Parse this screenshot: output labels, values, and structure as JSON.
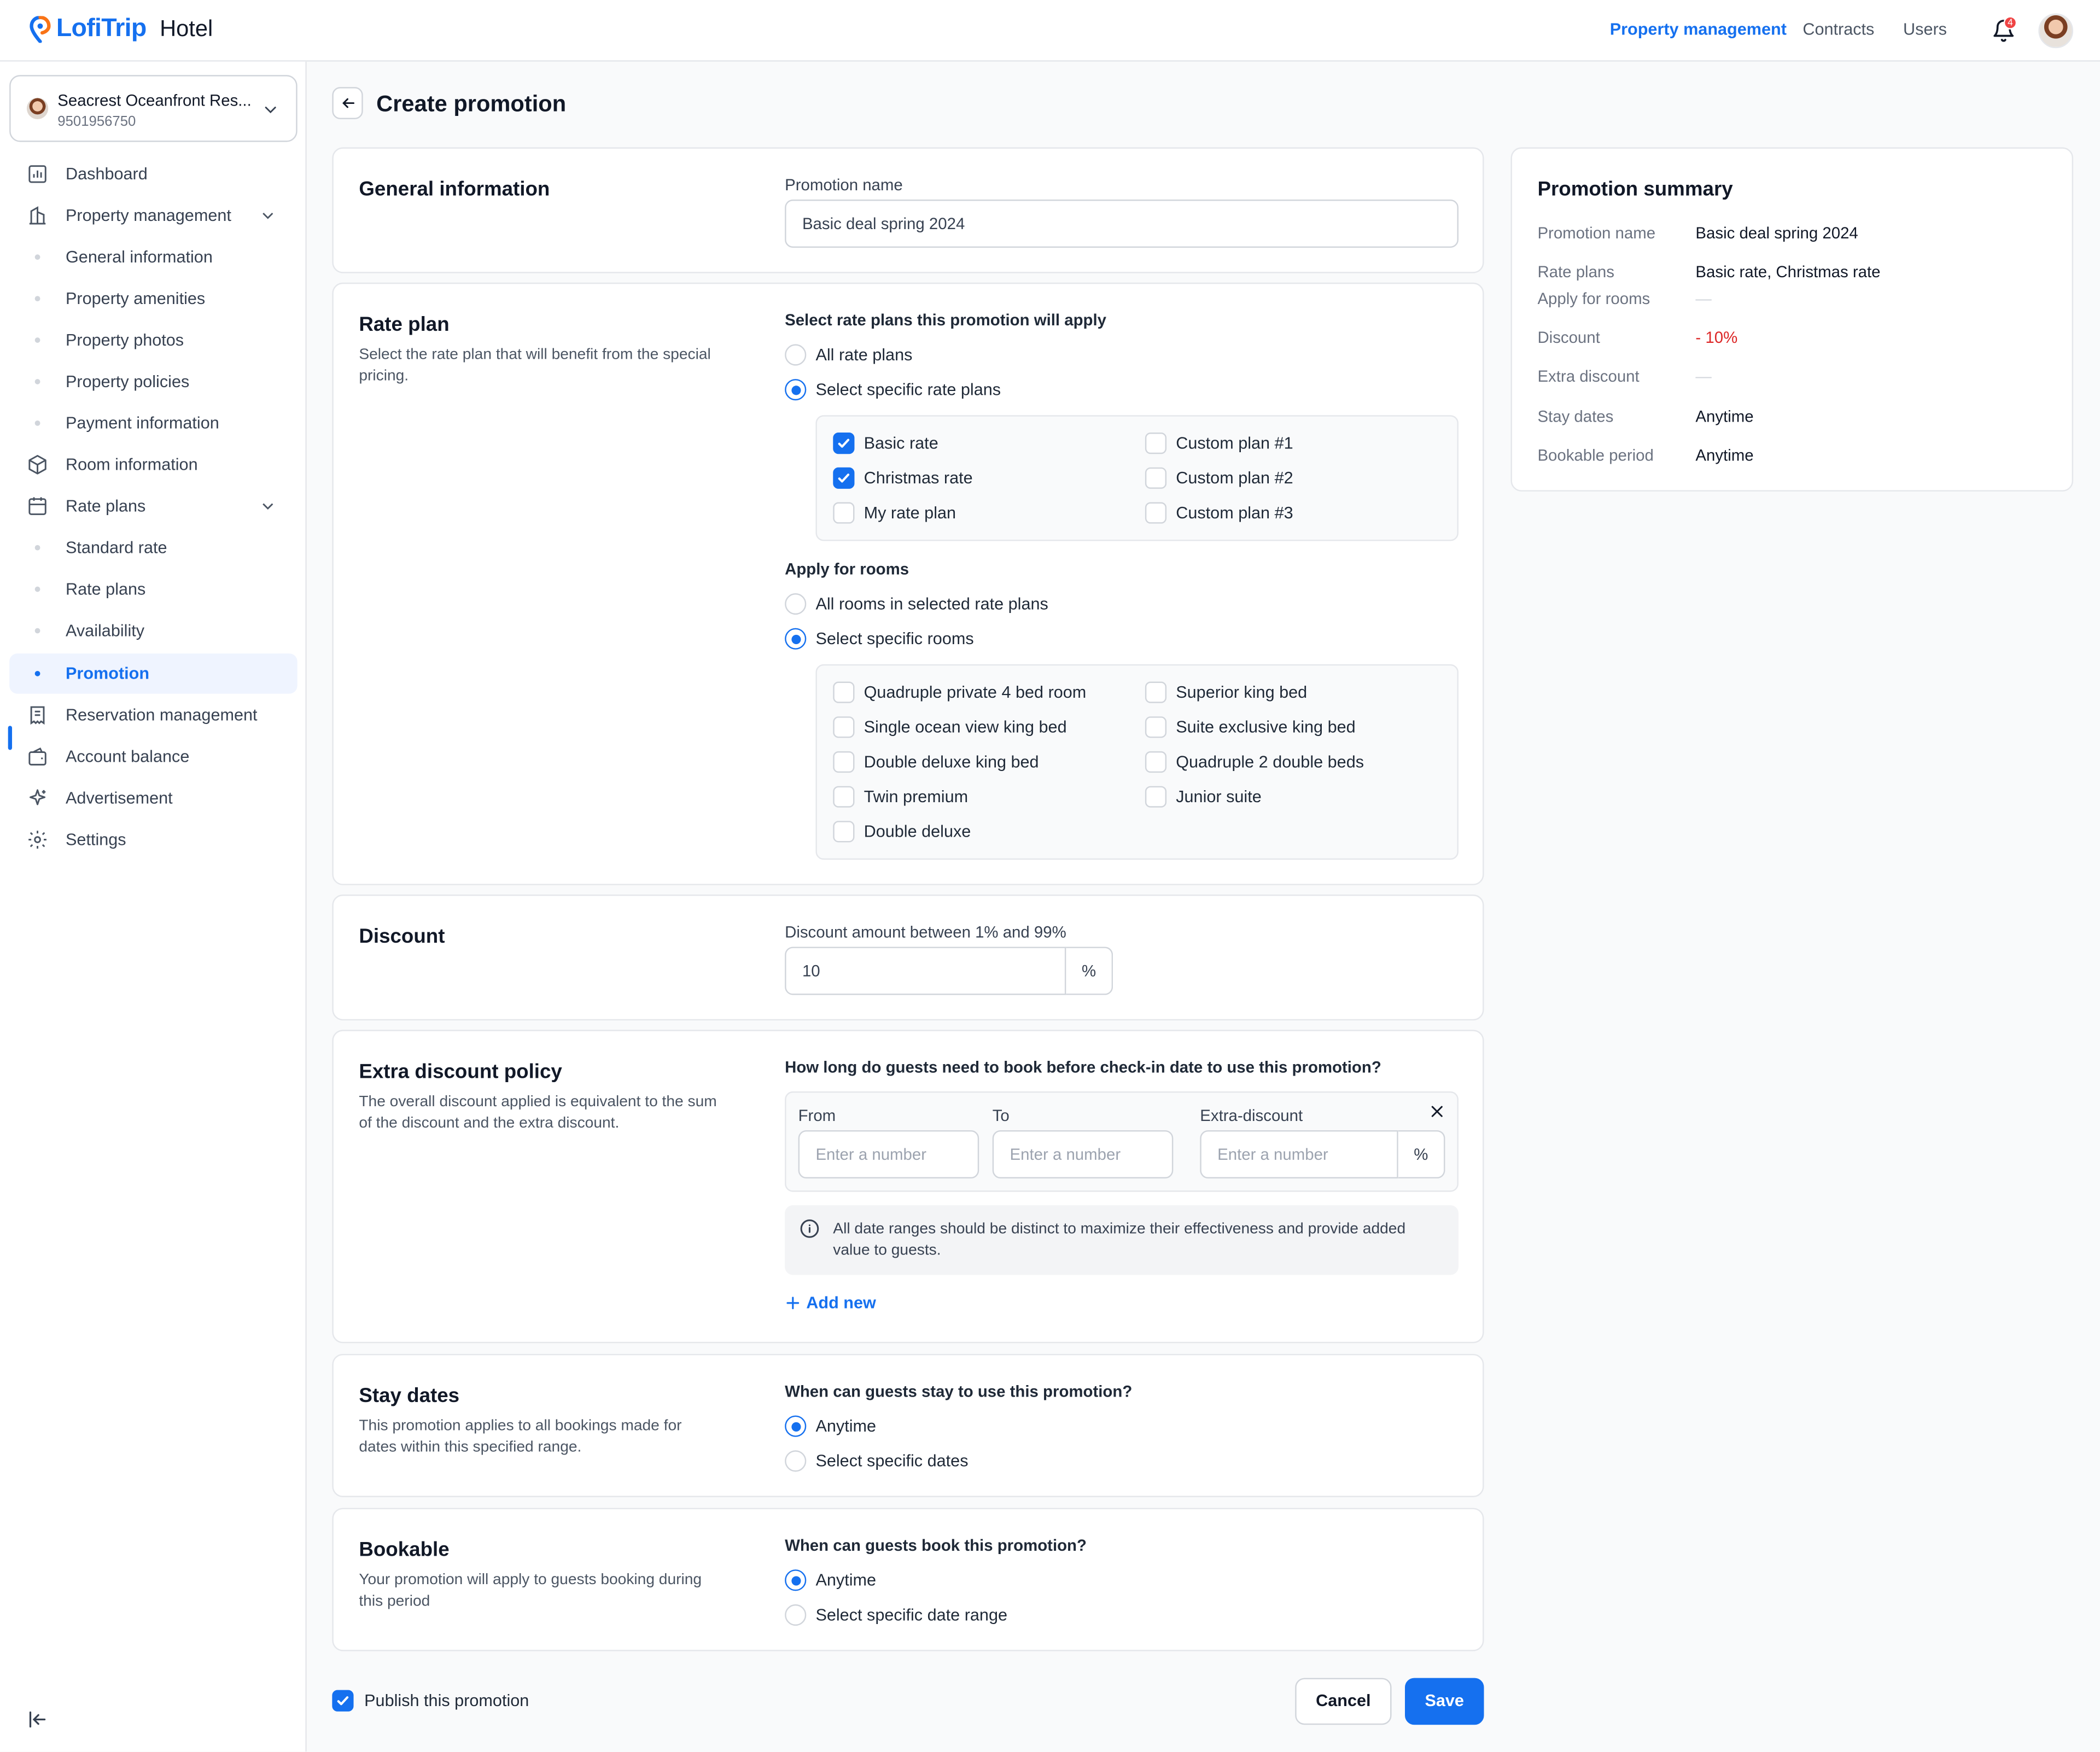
{
  "header": {
    "brand": "LofiTrip",
    "product": "Hotel",
    "nav": [
      {
        "label": "Property management",
        "active": true
      },
      {
        "label": "Contracts",
        "active": false
      },
      {
        "label": "Users",
        "active": false
      }
    ],
    "notification_count": "4",
    "accent_color": "#1570ef"
  },
  "sidebar": {
    "property": {
      "name": "Seacrest Oceanfront Res...",
      "id": "9501956750"
    },
    "items": [
      {
        "label": "Dashboard",
        "icon": "chart-bar-icon"
      },
      {
        "label": "Property management",
        "icon": "building-icon"
      },
      {
        "label": "General information"
      },
      {
        "label": "Property amenities"
      },
      {
        "label": "Property photos"
      },
      {
        "label": "Property policies"
      },
      {
        "label": "Payment information"
      },
      {
        "label": "Room information",
        "icon": "cube-icon"
      },
      {
        "label": "Rate plans",
        "icon": "calendar-icon"
      },
      {
        "label": "Standard rate"
      },
      {
        "label": "Rate plans"
      },
      {
        "label": "Availability"
      },
      {
        "label": "Promotion",
        "active": true
      },
      {
        "label": "Reservation management",
        "icon": "receipt-icon"
      },
      {
        "label": "Account balance",
        "icon": "wallet-icon"
      },
      {
        "label": "Advertisement",
        "icon": "sparkle-icon"
      },
      {
        "label": "Settings",
        "icon": "gear-icon"
      }
    ]
  },
  "page": {
    "title": "Create promotion"
  },
  "general": {
    "title": "General information",
    "name_label": "Promotion name",
    "name_value": "Basic deal spring 2024"
  },
  "rate_plan": {
    "title": "Rate plan",
    "desc": "Select the rate plan that will benefit from the special pricing.",
    "question": "Select rate plans this promotion will apply",
    "options": [
      "All rate plans",
      "Select specific rate plans"
    ],
    "plans": [
      {
        "label": "Basic rate",
        "checked": true
      },
      {
        "label": "Christmas rate",
        "checked": true
      },
      {
        "label": "My rate plan",
        "checked": false
      },
      {
        "label": "Custom plan #1",
        "checked": false
      },
      {
        "label": "Custom plan #2",
        "checked": false
      },
      {
        "label": "Custom plan #3",
        "checked": false
      }
    ],
    "rooms_question": "Apply for rooms",
    "rooms_options": [
      "All rooms in selected rate plans",
      "Select specific rooms"
    ],
    "rooms": [
      "Quadruple private 4 bed room",
      "Single ocean view king bed",
      "Double deluxe king bed",
      "Twin premium",
      "Double deluxe",
      "Superior king bed",
      "Suite exclusive king bed",
      "Quadruple 2 double beds",
      "Junior suite"
    ]
  },
  "discount": {
    "title": "Discount",
    "label": "Discount amount between 1% and 99%",
    "value": "10",
    "suffix": "%"
  },
  "extra": {
    "title": "Extra discount policy",
    "desc": "The overall discount applied is equivalent to the sum of the discount and the extra discount.",
    "question": "How long do guests need to book before check-in date to use this promotion?",
    "from_label": "From",
    "to_label": "To",
    "extra_label": "Extra-discount",
    "placeholder": "Enter a number",
    "suffix": "%",
    "info": "All date ranges should be distinct to maximize their effectiveness and provide added value to guests.",
    "add_new": "Add new"
  },
  "stay": {
    "title": "Stay dates",
    "desc": "This promotion applies to all bookings made for dates within this specified range.",
    "question": "When can guests stay to use this promotion?",
    "options": [
      "Anytime",
      "Select specific dates"
    ]
  },
  "bookable": {
    "title": "Bookable",
    "desc": "Your promotion will apply to guests booking during this period",
    "question": "When can guests book this promotion?",
    "options": [
      "Anytime",
      "Select specific date range"
    ]
  },
  "summary": {
    "title": "Promotion summary",
    "rows": [
      {
        "label": "Promotion name",
        "value": "Basic deal spring 2024"
      },
      {
        "label": "Rate plans",
        "value": "Basic rate, Christmas rate"
      },
      {
        "label": "Apply for rooms",
        "value": "—"
      },
      {
        "label": "Discount",
        "value": "- 10%"
      },
      {
        "label": "Extra discount",
        "value": "—"
      },
      {
        "label": "Stay dates",
        "value": "Anytime"
      },
      {
        "label": "Bookable period",
        "value": "Anytime"
      }
    ]
  },
  "footer": {
    "publish_label": "Publish this promotion",
    "publish_checked": true,
    "cancel_label": "Cancel",
    "save_label": "Save"
  }
}
